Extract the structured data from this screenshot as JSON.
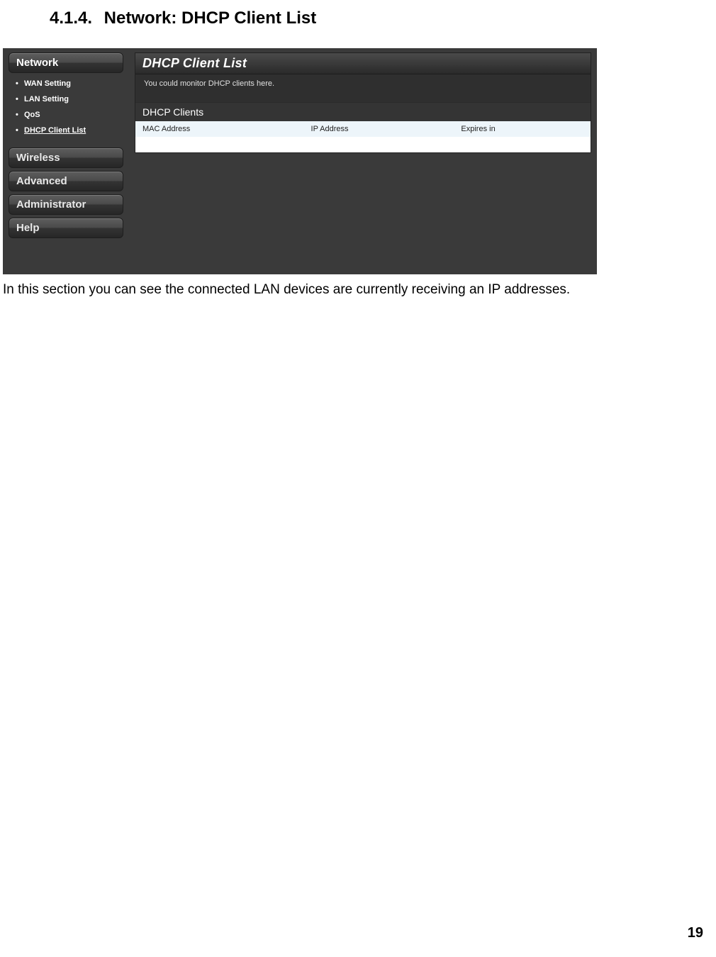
{
  "heading": {
    "number": "4.1.4.",
    "title": "Network: DHCP Client List"
  },
  "screenshot": {
    "sidebar": {
      "items": [
        {
          "label": "Network",
          "active": true,
          "sub": [
            {
              "label": "WAN Setting"
            },
            {
              "label": "LAN Setting"
            },
            {
              "label": "QoS"
            },
            {
              "label": "DHCP Client List",
              "current": true
            }
          ]
        },
        {
          "label": "Wireless"
        },
        {
          "label": "Advanced"
        },
        {
          "label": "Administrator"
        },
        {
          "label": "Help"
        }
      ]
    },
    "content": {
      "title": "DHCP Client List",
      "description": "You could monitor DHCP clients here.",
      "section_title": "DHCP Clients",
      "columns": [
        "MAC Address",
        "IP Address",
        "Expires in"
      ]
    }
  },
  "caption": "In this section you can see the connected LAN devices are currently receiving an IP addresses.",
  "page_number": "19"
}
